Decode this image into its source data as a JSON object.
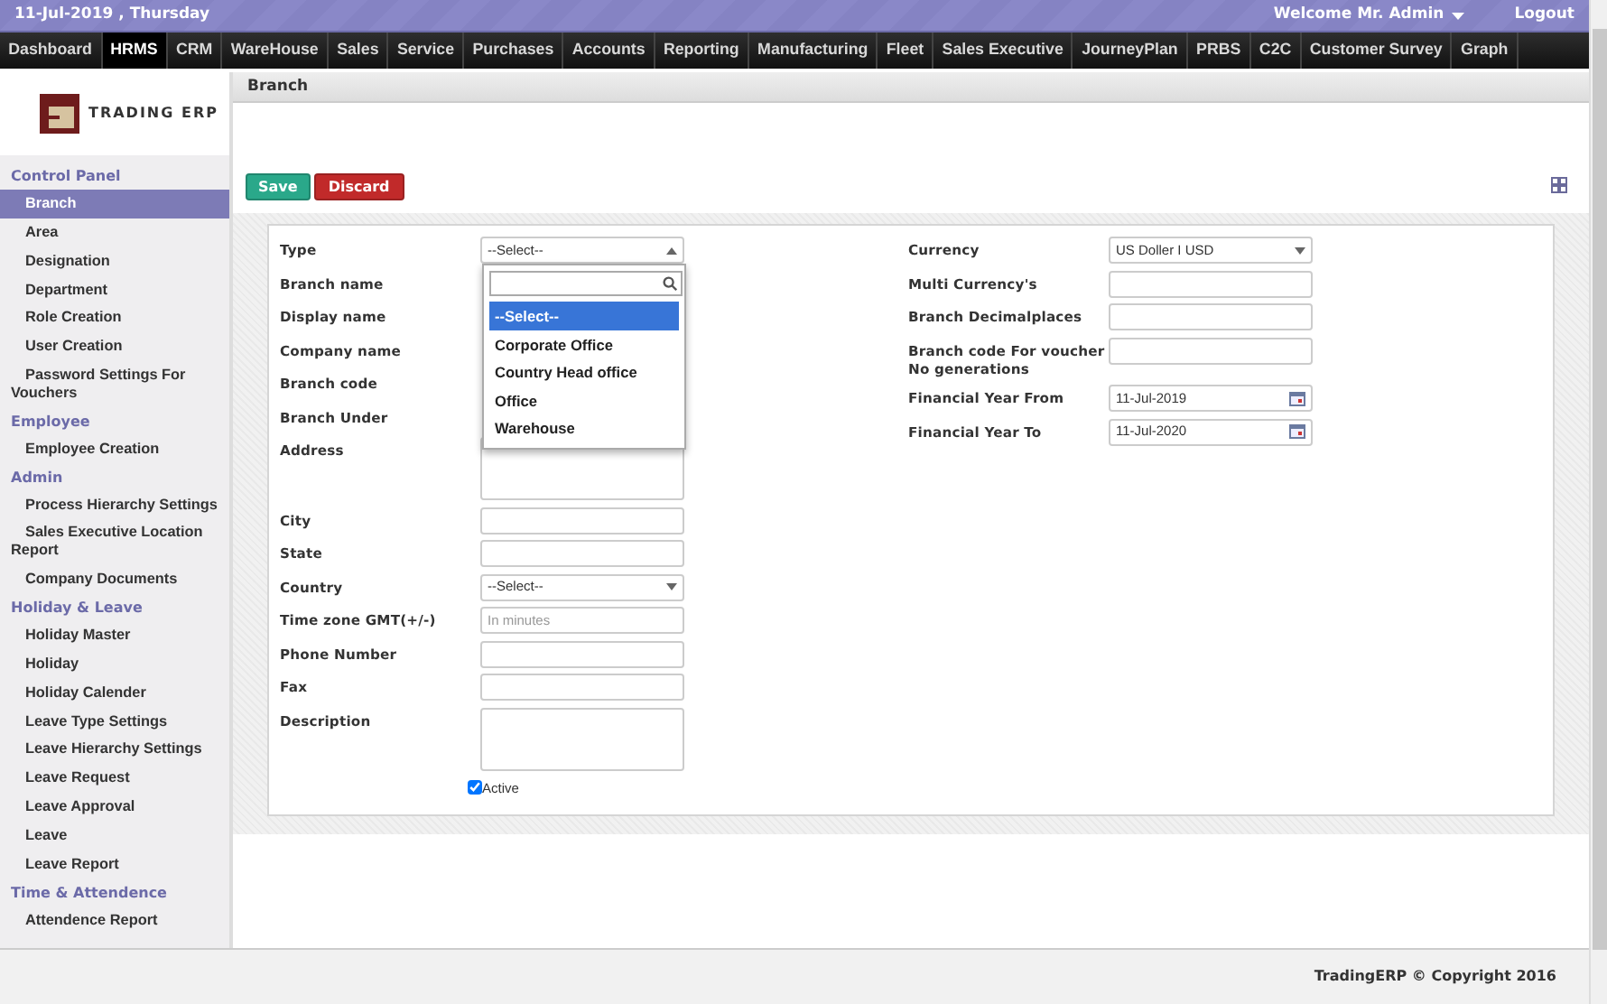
{
  "top_bar": {
    "date": "11-Jul-2019 , Thursday",
    "welcome": "Welcome Mr. Admin",
    "logout": "Logout"
  },
  "menu": [
    {
      "label": "Dashboard",
      "selected": false
    },
    {
      "label": "HRMS",
      "selected": true
    },
    {
      "label": "CRM",
      "selected": false
    },
    {
      "label": "WareHouse",
      "selected": false
    },
    {
      "label": "Sales",
      "selected": false
    },
    {
      "label": "Service",
      "selected": false
    },
    {
      "label": "Purchases",
      "selected": false
    },
    {
      "label": "Accounts",
      "selected": false
    },
    {
      "label": "Reporting",
      "selected": false
    },
    {
      "label": "Manufacturing",
      "selected": false
    },
    {
      "label": "Fleet",
      "selected": false
    },
    {
      "label": "Sales Executive",
      "selected": false
    },
    {
      "label": "JourneyPlan",
      "selected": false
    },
    {
      "label": "PRBS",
      "selected": false
    },
    {
      "label": "C2C",
      "selected": false
    },
    {
      "label": "Customer Survey",
      "selected": false
    },
    {
      "label": "Graph",
      "selected": false
    }
  ],
  "logo": {
    "text": "TRADING ERP"
  },
  "sidebar": [
    {
      "section": "Control Panel",
      "items": [
        {
          "label": "Branch",
          "selected": true
        },
        {
          "label": "Area",
          "selected": false
        },
        {
          "label": "Designation",
          "selected": false
        },
        {
          "label": "Department",
          "selected": false
        },
        {
          "label": "Role Creation",
          "selected": false
        },
        {
          "label": "User Creation",
          "selected": false
        },
        {
          "label": "Password Settings For Vouchers",
          "selected": false
        }
      ]
    },
    {
      "section": "Employee",
      "items": [
        {
          "label": "Employee Creation",
          "selected": false
        }
      ]
    },
    {
      "section": "Admin",
      "items": [
        {
          "label": "Process Hierarchy Settings",
          "selected": false
        },
        {
          "label": "Sales Executive Location Report",
          "selected": false
        },
        {
          "label": "Company Documents",
          "selected": false
        }
      ]
    },
    {
      "section": "Holiday & Leave",
      "items": [
        {
          "label": "Holiday Master",
          "selected": false
        },
        {
          "label": "Holiday",
          "selected": false
        },
        {
          "label": "Holiday Calender",
          "selected": false
        },
        {
          "label": "Leave Type Settings",
          "selected": false
        },
        {
          "label": "Leave Hierarchy Settings",
          "selected": false
        },
        {
          "label": "Leave Request",
          "selected": false
        },
        {
          "label": "Leave Approval",
          "selected": false
        },
        {
          "label": "Leave",
          "selected": false
        },
        {
          "label": "Leave Report",
          "selected": false
        }
      ]
    },
    {
      "section": "Time & Attendence",
      "items": [
        {
          "label": "Attendence Report",
          "selected": false
        }
      ]
    }
  ],
  "page_title": "Branch",
  "buttons": [
    {
      "label": "Save",
      "kind": "save"
    },
    {
      "label": "Discard",
      "kind": "discard"
    }
  ],
  "form": {
    "left": [
      {
        "label": "Type",
        "kind": "select",
        "value": "--Select--",
        "expanded": true
      },
      {
        "label": "Branch name",
        "kind": "covered"
      },
      {
        "label": "Display name",
        "kind": "covered"
      },
      {
        "label": "Company name",
        "kind": "covered"
      },
      {
        "label": "Branch code",
        "kind": "covered"
      },
      {
        "label": "Branch Under",
        "kind": "covered"
      },
      {
        "label": "Address",
        "kind": "textarea"
      },
      {
        "label": "City",
        "kind": "text"
      },
      {
        "label": "State",
        "kind": "text"
      },
      {
        "label": "Country",
        "kind": "select",
        "value": "--Select--",
        "expanded": false
      },
      {
        "label": "Time zone GMT(+/-)",
        "kind": "text",
        "placeholder": "In minutes"
      },
      {
        "label": "Phone Number",
        "kind": "text"
      },
      {
        "label": "Fax",
        "kind": "text"
      },
      {
        "label": "Description",
        "kind": "textarea"
      }
    ],
    "active": {
      "label": "Active",
      "checked": true
    },
    "right": [
      {
        "label": "Currency",
        "kind": "select",
        "value": "US Doller I USD",
        "expanded": false
      },
      {
        "label": "Multi Currency's",
        "kind": "text"
      },
      {
        "label": "Branch Decimalplaces",
        "kind": "text"
      },
      {
        "label": "Branch code For voucher No generations",
        "kind": "text"
      },
      {
        "label": "Financial Year From",
        "kind": "date",
        "value": "11-Jul-2019"
      },
      {
        "label": "Financial Year To",
        "kind": "date",
        "value": "11-Jul-2020"
      }
    ]
  },
  "type_dropdown": {
    "options": [
      {
        "label": "--Select--",
        "selected": true
      },
      {
        "label": "Corporate Office",
        "selected": false
      },
      {
        "label": "Country Head office",
        "selected": false
      },
      {
        "label": "Office",
        "selected": false
      },
      {
        "label": "Warehouse",
        "selected": false
      }
    ]
  },
  "footer": "TradingERP © Copyright 2016"
}
